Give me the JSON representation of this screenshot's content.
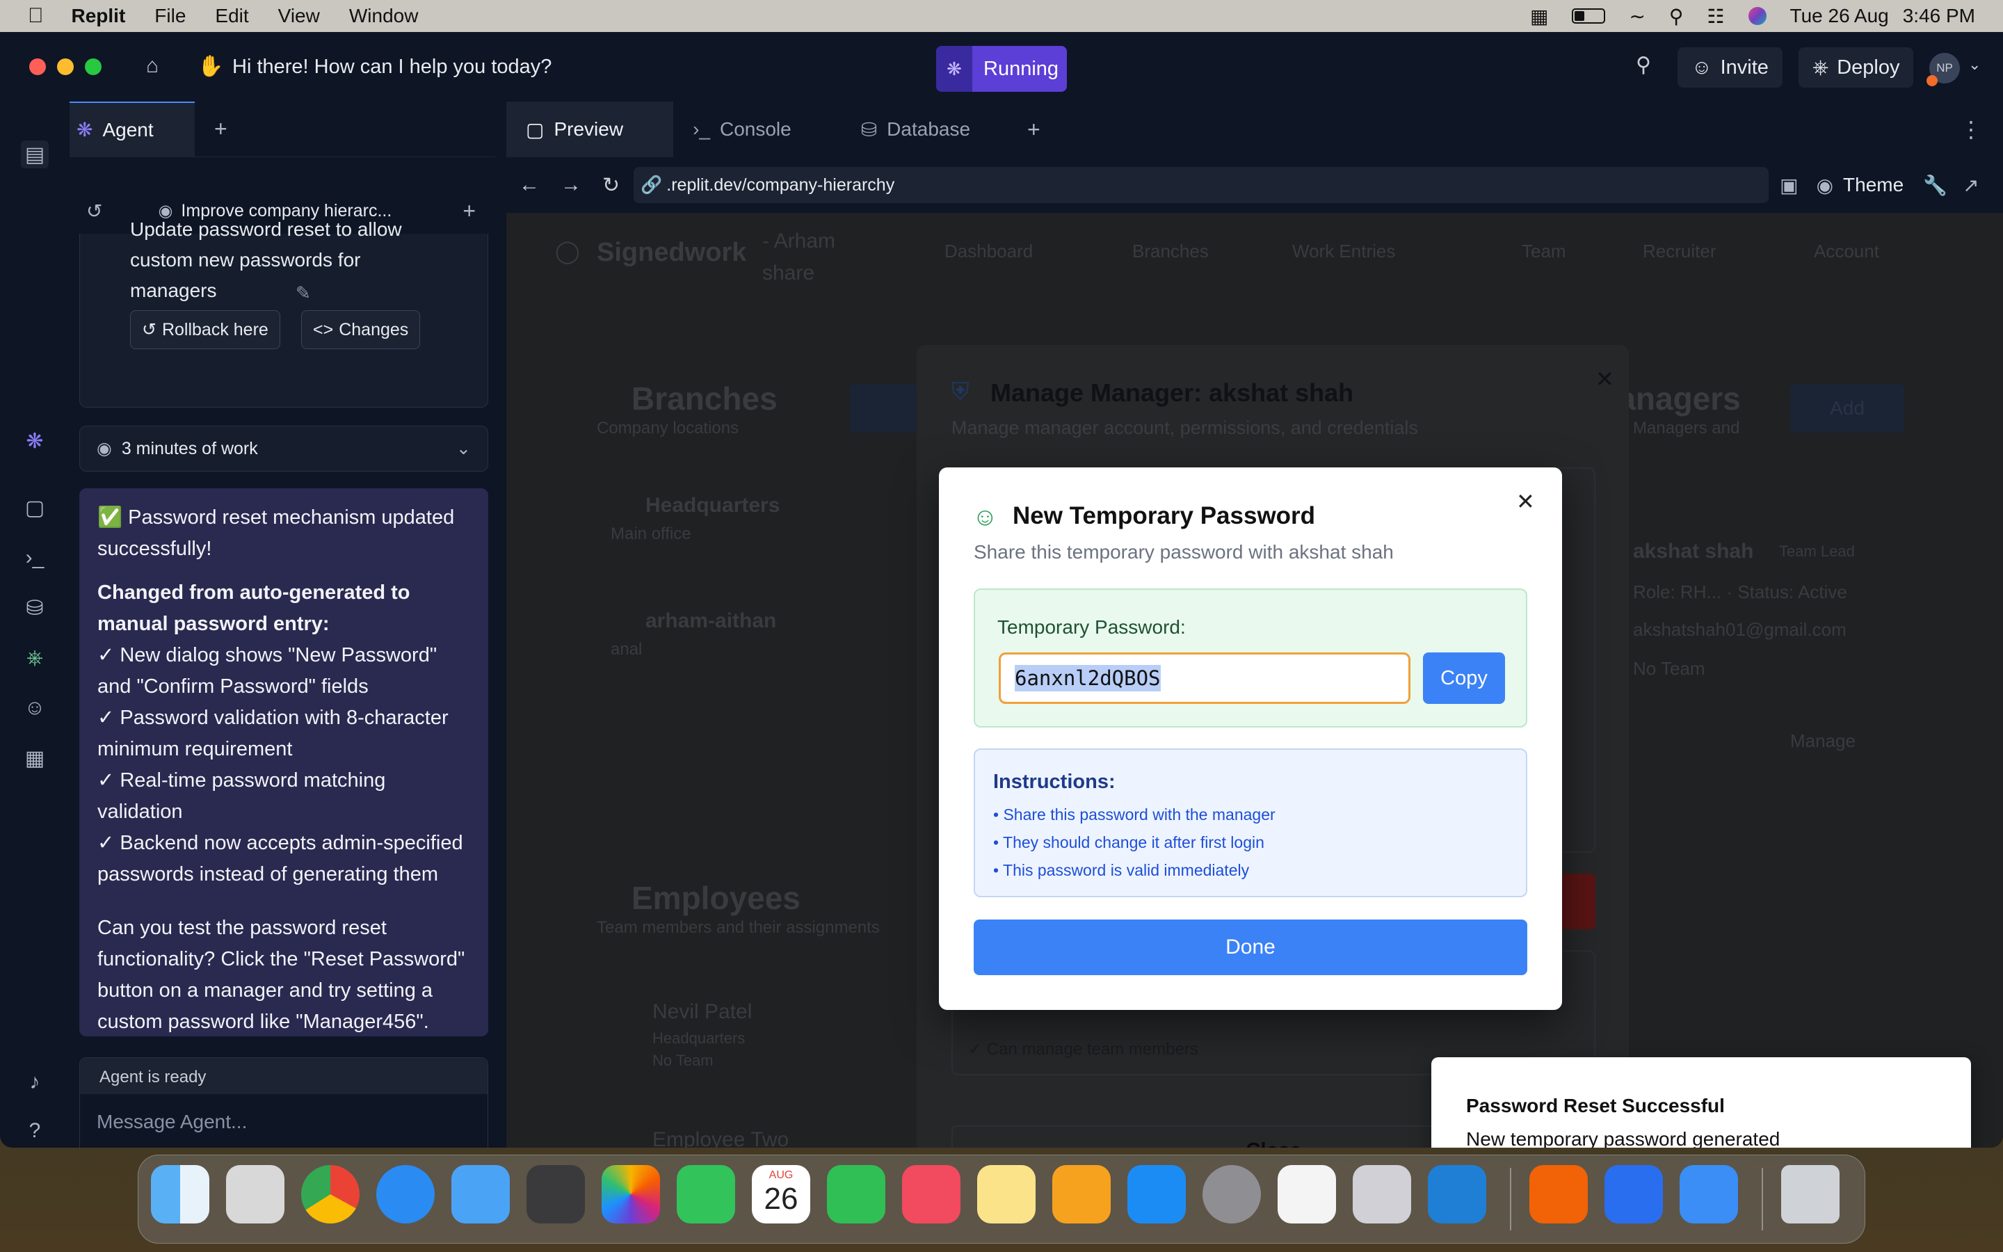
{
  "menubar": {
    "app": "Replit",
    "items": [
      "File",
      "Edit",
      "View",
      "Window"
    ],
    "date": "Tue 26 Aug",
    "time": "3:46 PM"
  },
  "titlebar": {
    "greeting": "Hi there! How can I help you today?",
    "status": "Running",
    "invite": "Invite",
    "deploy": "Deploy",
    "avatar": "NP"
  },
  "agent": {
    "tab_label": "Agent",
    "thread_title": "Improve company hierarc...",
    "prev_message": "Update password reset to allow custom new passwords for managers",
    "rollback": "Rollback here",
    "changes": "Changes",
    "work_summary": "3 minutes of work",
    "message": {
      "line1": "✅ Password reset mechanism updated successfully!",
      "heading": "Changed from auto-generated to manual password entry:",
      "bullets": [
        "✓ New dialog shows \"New Password\" and \"Confirm Password\" fields",
        "✓ Password validation with 8-character minimum requirement",
        "✓ Real-time password matching validation",
        "✓ Backend now accepts admin-specified passwords instead of generating them"
      ],
      "closing": "Can you test the password reset functionality? Click the \"Reset Password\" button on a manager and try setting a custom password like \"Manager456\"."
    },
    "ready": "Agent is ready",
    "input_placeholder": "Message Agent..."
  },
  "preview": {
    "tabs": [
      "Preview",
      "Console",
      "Database"
    ],
    "url": ".replit.dev/company-hierarchy",
    "theme": "Theme"
  },
  "background_app": {
    "brand": "Signedwork",
    "org_line1": "- Arham",
    "org_line2": "share",
    "nav": [
      "Dashboard",
      "Branches",
      "Work Entries",
      "Team",
      "Recruiter",
      "Account"
    ],
    "branches_title": "Branches",
    "branches_sub": "Company locations",
    "branch1": "Headquarters",
    "branch1_sub": "Main office",
    "branch2": "arham-aithan",
    "branch2_sub": "anal",
    "managers_title": "Managers",
    "managers_sub": "Managers and",
    "manager_name": "akshat shah",
    "manager_badge": "Team Lead",
    "manager_meta": "Role: RH... · Status: Active",
    "manager_email": "akshatshah01@gmail.com",
    "manager_team": "No Team",
    "manage_btn": "Manage",
    "add_btn": "Add",
    "employees_title": "Employees",
    "employees_sub": "Team members and their assignments",
    "emp1": "Nevil Patel",
    "emp1_sub1": "Headquarters",
    "emp1_sub2": "No Team",
    "emp2": "Employee Two"
  },
  "manager_dialog": {
    "title": "Manage Manager: akshat shah",
    "subtitle": "Manage manager account, permissions, and credentials",
    "permission": "✓ Can manage team members",
    "close": "Close"
  },
  "password_dialog": {
    "title": "New Temporary Password",
    "subtitle": "Share this temporary password with akshat shah",
    "field_label": "Temporary Password:",
    "password": "6anxnl2dQBOS",
    "copy": "Copy",
    "instructions_title": "Instructions:",
    "instructions": [
      "• Share this password with the manager",
      "• They should change it after first login",
      "• This password is valid immediately"
    ],
    "done": "Done"
  },
  "toast": {
    "title": "Password Reset Successful",
    "body": "New temporary password generated"
  },
  "dock": {
    "calendar_month": "AUG",
    "calendar_day": "26"
  },
  "colors": {
    "primary_blue": "#3b82f6",
    "running_purple": "#5b3fd6",
    "agent_msg_bg": "#2a2950",
    "success_green": "#e9f9ee"
  }
}
